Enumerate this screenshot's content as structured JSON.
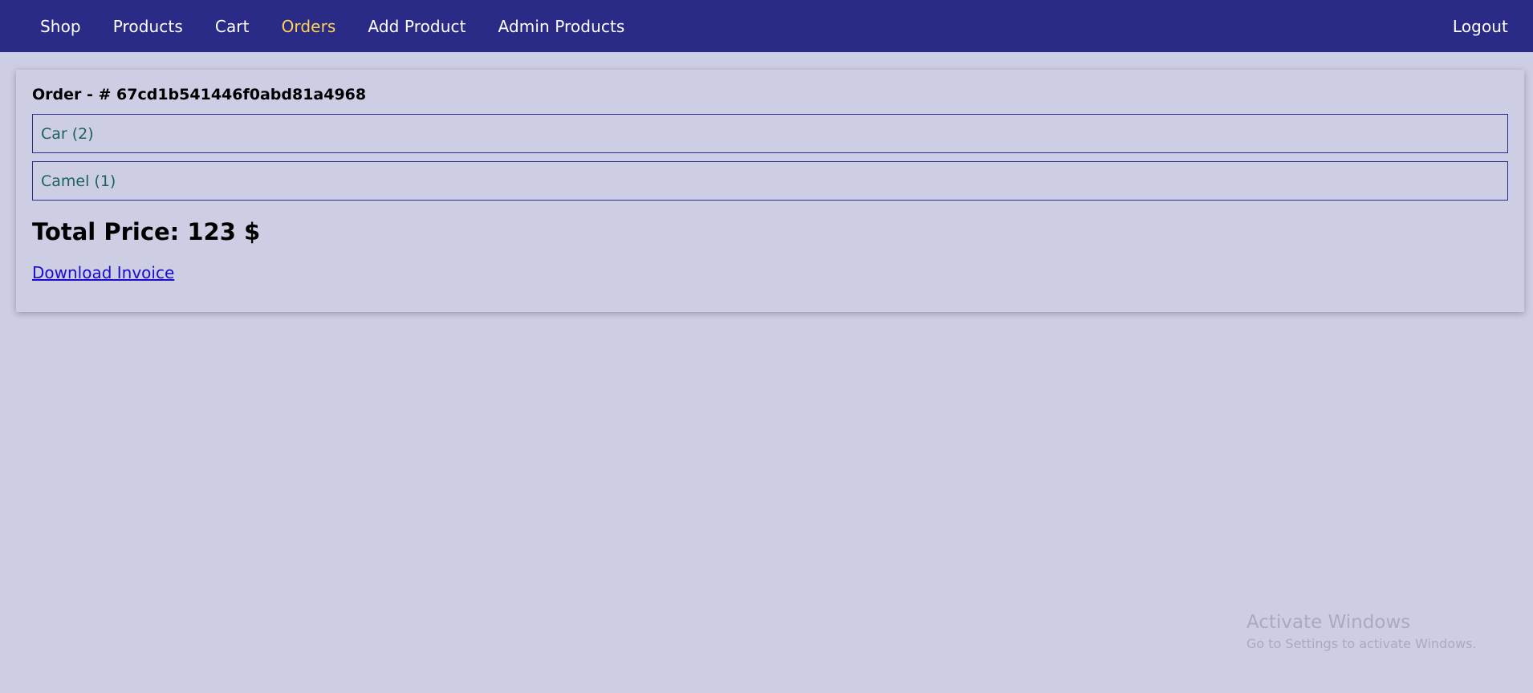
{
  "nav": {
    "links": [
      {
        "label": "Shop"
      },
      {
        "label": "Products"
      },
      {
        "label": "Cart"
      },
      {
        "label": "Orders"
      },
      {
        "label": "Add Product"
      },
      {
        "label": "Admin Products"
      }
    ],
    "logout_label": "Logout",
    "active_link": "Orders",
    "background_color": "#2a2a87",
    "active_color": "#ffd54f"
  },
  "order": {
    "title": "Order - # 67cd1b541446f0abd81a4968",
    "items": [
      {
        "label": "Car (2)"
      },
      {
        "label": "Camel (1)"
      }
    ],
    "total_price": "Total Price: 123 $",
    "download_label": "Download Invoice"
  },
  "watermark": {
    "title": "Activate Windows",
    "subtitle": "Go to Settings to activate Windows."
  }
}
